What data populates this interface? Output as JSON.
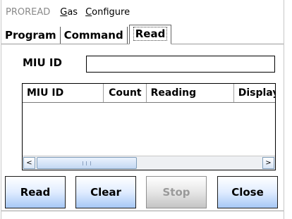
{
  "menubar": {
    "app_name": "PROREAD",
    "items": [
      {
        "mnemonic": "G",
        "rest": "as"
      },
      {
        "mnemonic": "C",
        "rest": "onfigure"
      }
    ]
  },
  "tabs": [
    {
      "label": "Program",
      "active": false
    },
    {
      "label": "Command",
      "active": false
    },
    {
      "label": "Read",
      "active": true
    }
  ],
  "form": {
    "miu_id_label": "MIU ID",
    "miu_id_value": ""
  },
  "list": {
    "columns": [
      "MIU ID",
      "Count",
      "Reading",
      "Display"
    ],
    "rows": [],
    "scroll": {
      "left_arrow": "<",
      "right_arrow": ">"
    }
  },
  "buttons": {
    "read": "Read",
    "clear": "Clear",
    "stop": "Stop",
    "stop_enabled": false,
    "close": "Close"
  },
  "colors": {
    "button_top": "#ffffff",
    "button_bottom": "#a6c8f5",
    "disabled_text": "#9a9a9a",
    "app_name_text": "#8a8a8a"
  }
}
